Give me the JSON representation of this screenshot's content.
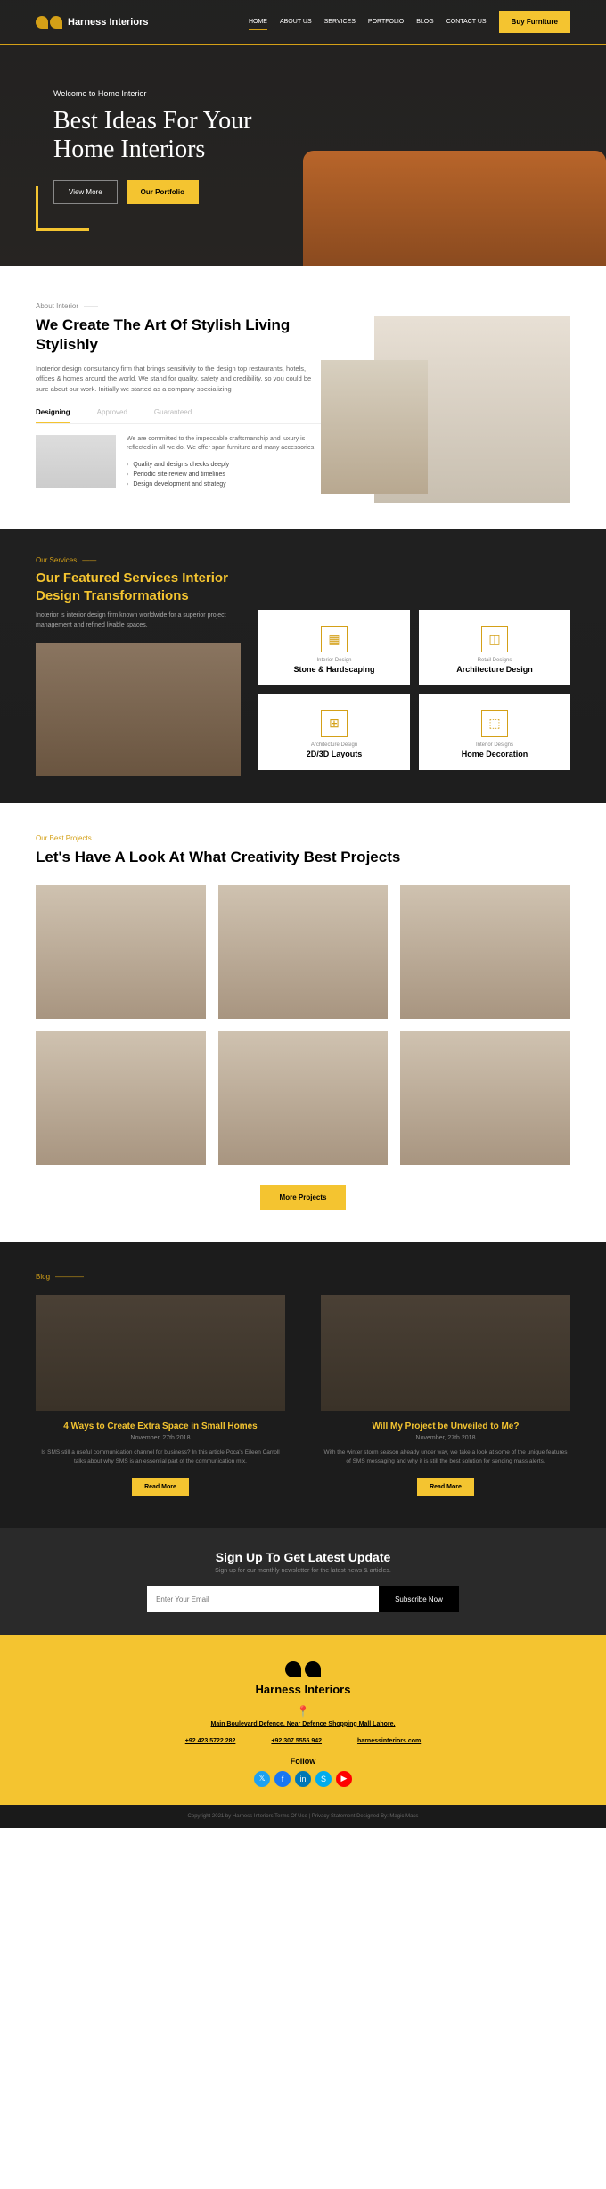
{
  "nav": {
    "brand": "Harness Interiors",
    "links": [
      "HOME",
      "ABOUT US",
      "SERVICES",
      "PORTFOLIO",
      "BLOG",
      "CONTACT US"
    ],
    "buy": "Buy Furniture"
  },
  "hero": {
    "welcome": "Welcome to Home Interior",
    "title1": "Best Ideas For Your",
    "title2": "Home Interiors",
    "viewMore": "View More",
    "portfolio": "Our Portfolio"
  },
  "about": {
    "label": "About Interior",
    "title": "We Create The Art Of Stylish Living Stylishly",
    "text": "Inoterior design consultancy firm that brings sensitivity to the design top restaurants, hotels, offices & homes around the world. We stand for quality, safety and credibility, so you could be sure about our work. Initially we started as a company specializing",
    "tabs": [
      "Designing",
      "Approved",
      "Guaranteed"
    ],
    "tabDesc": "We are committed to the impeccable craftsmanship and luxury is reflected in all we do. We offer span furniture and many accessories.",
    "tabList": [
      "Quality and designs checks deeply",
      "Periodic site review and timelines",
      "Design development and strategy"
    ]
  },
  "services": {
    "label": "Our Services",
    "title": "Our Featured Services Interior Design Transformations",
    "text": "Inoterior is interior design firm known worldwide for a superior project management and refined livable spaces.",
    "cards": [
      {
        "sub": "Interior Design",
        "name": "Stone & Hardscaping"
      },
      {
        "sub": "Retail Designs",
        "name": "Architecture Design"
      },
      {
        "sub": "Architecture Design",
        "name": "2D/3D Layouts"
      },
      {
        "sub": "Interior Designs",
        "name": "Home Decoration"
      }
    ]
  },
  "projects": {
    "label": "Our Best Projects",
    "title": "Let's Have A Look At What Creativity Best Projects",
    "more": "More Projects"
  },
  "blog": {
    "label": "Blog",
    "posts": [
      {
        "title": "4 Ways to Create Extra Space in Small Homes",
        "date": "November, 27th 2018",
        "text": "Is SMS still a useful communication channel for business? In this article Poca's Eileen Carroll talks about why SMS is an essential part of the communication mix.",
        "btn": "Read More"
      },
      {
        "title": "Will My Project be Unveiled to Me?",
        "date": "November, 27th 2018",
        "text": "With the winter storm season already under way, we take a look at some of the unique features of SMS messaging and why it is still the best solution for sending mass alerts.",
        "btn": "Read More"
      }
    ]
  },
  "newsletter": {
    "title": "Sign Up To Get Latest Update",
    "sub": "Sign up for our monthly newsletter for the latest news & articles.",
    "placeholder": "Enter Your Email",
    "btn": "Subscribe Now"
  },
  "footer": {
    "brand": "Harness Interiors",
    "addr": "Main Boulevard Defence, Near Defence Shopping Mall Lahore.",
    "contacts": [
      "+92 423 5722 282",
      "+92 307 5555 942",
      "harnessinteriors.com"
    ],
    "follow": "Follow"
  },
  "copyright": "Copyright 2021 by Harness Interiors Terms Of Use | Privacy Statement   Designed By: Magic Mass"
}
